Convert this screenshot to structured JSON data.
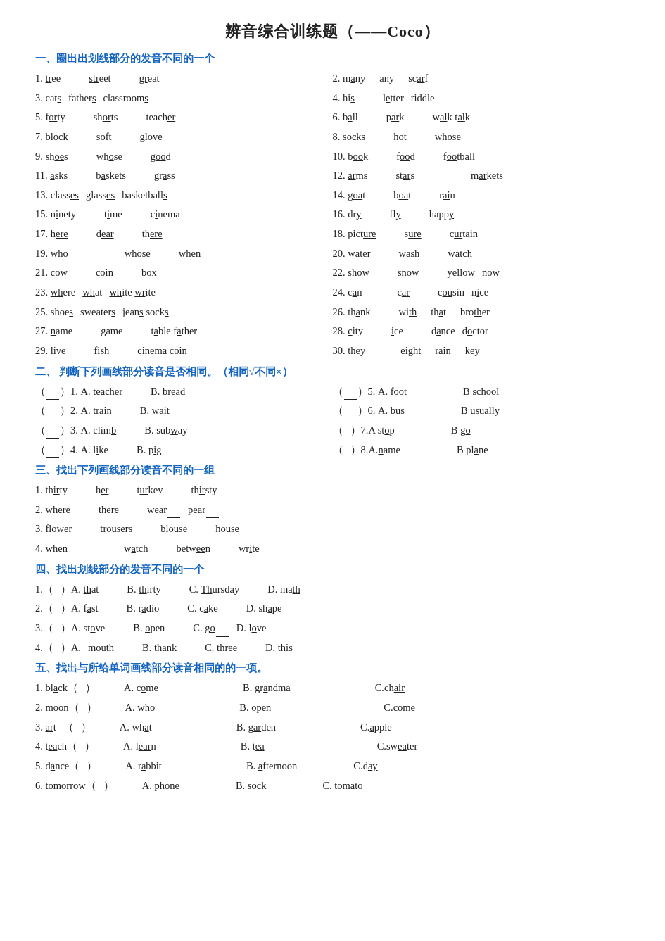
{
  "title": "辨音综合训练题（——Coco）",
  "section1": {
    "title": "一、圈出出划线部分的发音不同的一个",
    "rows": [
      {
        "left": {
          "num": "1.",
          "words": [
            "tree",
            "street",
            "great"
          ]
        },
        "right": {
          "num": "2.",
          "words": [
            "many",
            "any",
            "scarf"
          ]
        }
      },
      {
        "left": {
          "num": "3.",
          "words": [
            "cats",
            "fathers",
            "classrooms"
          ]
        },
        "right": {
          "num": "4.",
          "words": [
            "his",
            "letter",
            "riddle"
          ]
        }
      },
      {
        "left": {
          "num": "5.",
          "words": [
            "forty",
            "shorts",
            "teacher"
          ]
        },
        "right": {
          "num": "6.",
          "words": [
            "ball",
            "park",
            "walk talk"
          ]
        }
      },
      {
        "left": {
          "num": "7.",
          "words": [
            "block",
            "soft",
            "glove"
          ]
        },
        "right": {
          "num": "8.",
          "words": [
            "socks",
            "hot",
            "whose"
          ]
        }
      },
      {
        "left": {
          "num": "9.",
          "words": [
            "shoes",
            "whose",
            "good"
          ]
        },
        "right": {
          "num": "10.",
          "words": [
            "book",
            "food",
            "football"
          ]
        }
      },
      {
        "left": {
          "num": "11.",
          "words": [
            "asks",
            "baskets",
            "grass"
          ]
        },
        "right": {
          "num": "12.",
          "words": [
            "arms",
            "stars",
            "markets"
          ]
        }
      },
      {
        "left": {
          "num": "13.",
          "words": [
            "classes",
            "glasses",
            "basketballs"
          ]
        },
        "right": {
          "num": "14.",
          "words": [
            "goat",
            "boat",
            "rain"
          ]
        }
      },
      {
        "left": {
          "num": "15.",
          "words": [
            "ninety",
            "time",
            "cinema"
          ]
        },
        "right": {
          "num": "16.",
          "words": [
            "dry",
            "fly",
            "happy"
          ]
        }
      },
      {
        "left": {
          "num": "17.",
          "words": [
            "here",
            "dear",
            "there"
          ]
        },
        "right": {
          "num": "18.",
          "words": [
            "picture",
            "sure",
            "curtain"
          ]
        }
      },
      {
        "left": {
          "num": "19.",
          "words": [
            "who",
            "whose",
            "when"
          ]
        },
        "right": {
          "num": "20.",
          "words": [
            "water",
            "wash",
            "watch"
          ]
        }
      },
      {
        "left": {
          "num": "21.",
          "words": [
            "cow",
            "coin",
            "box"
          ]
        },
        "right": {
          "num": "22.",
          "words": [
            "show",
            "snow",
            "yellow now"
          ]
        }
      },
      {
        "left": {
          "num": "23.",
          "words": [
            "where",
            "what",
            "white write"
          ]
        },
        "right": {
          "num": "24.",
          "words": [
            "can",
            "car",
            "cousin nice"
          ]
        }
      },
      {
        "left": {
          "num": "25.",
          "words": [
            "shoes",
            "sweaters",
            "jeans socks"
          ]
        },
        "right": {
          "num": "26.",
          "words": [
            "thank",
            "with",
            "that brother"
          ]
        }
      },
      {
        "left": {
          "num": "27.",
          "words": [
            "name",
            "game",
            "table father"
          ]
        },
        "right": {
          "num": "28.",
          "words": [
            "city",
            "ice",
            "dance doctor"
          ]
        }
      },
      {
        "left": {
          "num": "29.",
          "words": [
            "live",
            "fish",
            "cinema coin"
          ]
        },
        "right": {
          "num": "30.",
          "words": [
            "they",
            "eight",
            "rain key"
          ]
        }
      }
    ]
  },
  "section2": {
    "title": "二、 判断下列画线部分读音是否相同。（相同√不同×）",
    "rows": [
      {
        "left": {
          "num": "1.",
          "a": "A. teacher",
          "b": "B. bread"
        },
        "right": {
          "num": "5.",
          "a": "A. foot",
          "b": "B school"
        }
      },
      {
        "left": {
          "num": "2.",
          "a": "A. train",
          "b": "B. wait"
        },
        "right": {
          "num": "6.",
          "a": "A. bus",
          "b": "B usually"
        }
      },
      {
        "left": {
          "num": "3.",
          "a": "A. climb",
          "b": "B. subway"
        },
        "right": {
          "num": "7.",
          "a": "A stop",
          "b": "B go"
        }
      },
      {
        "left": {
          "num": "4.",
          "a": "A. like",
          "b": "B. pig"
        },
        "right": {
          "num": "8.",
          "a": "A.name",
          "b": "B plane"
        }
      }
    ]
  },
  "section3": {
    "title": "三、找出下列画线部分读音不同的一组",
    "rows": [
      {
        "num": "1.",
        "words": [
          "thirty",
          "her",
          "turkey",
          "thirsty"
        ]
      },
      {
        "num": "2.",
        "words": [
          "where",
          "there",
          "wear",
          "pear"
        ]
      },
      {
        "num": "3.",
        "words": [
          "flower",
          "trousers",
          "blouse",
          "house"
        ]
      },
      {
        "num": "4.",
        "words": [
          "when",
          "watch",
          "between",
          "write"
        ]
      }
    ]
  },
  "section4": {
    "title": "四、找出划线部分的发音不同的一个",
    "rows": [
      {
        "num": "1.",
        "a": "A. that",
        "b": "B. thirty",
        "c": "C. Thursday",
        "d": "D. math"
      },
      {
        "num": "2.",
        "a": "A. fast",
        "b": "B. radio",
        "c": "C. cake",
        "d": "D. shape"
      },
      {
        "num": "3.",
        "a": "A. stove",
        "b": "B. open",
        "c": "C. go",
        "d": "D. love"
      },
      {
        "num": "4.",
        "a": "A.  mouth",
        "b": "B. thank",
        "c": "C. three",
        "d": "D. this"
      }
    ]
  },
  "section5": {
    "title": "五、找出与所给单词画线部分读音相同的的一项。",
    "rows": [
      {
        "num": "1.",
        "word": "black",
        "a": "A. come",
        "b": "B. grandma",
        "c": "C.chair"
      },
      {
        "num": "2.",
        "word": "moon",
        "a": "A. who",
        "b": "B. open",
        "c": "C.come"
      },
      {
        "num": "3.",
        "word": "art",
        "a": "A. what",
        "b": "B. garden",
        "c": "C.apple"
      },
      {
        "num": "4.",
        "word": "teach",
        "a": "A. learn",
        "b": "B. tea",
        "c": "C.sweater"
      },
      {
        "num": "5.",
        "word": "dance",
        "a": "A. rabbit",
        "b": "B. afternoon",
        "c": "C.day"
      },
      {
        "num": "6.",
        "word": "tomorrow",
        "a": "A. phone",
        "b": "B. sock",
        "c": "C. tomato"
      }
    ]
  }
}
